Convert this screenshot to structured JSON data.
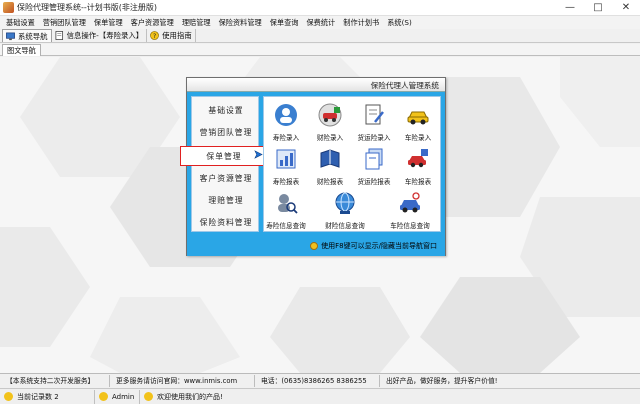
{
  "window": {
    "title": "保险代理管理系统--计划书版(非注册版)"
  },
  "menubar": {
    "items": [
      "基础设置",
      "营销团队管理",
      "保单管理",
      "客户资源管理",
      "理赔管理",
      "保险资料管理",
      "保单查询",
      "保费统计",
      "制作计划书",
      "系统(S)"
    ]
  },
  "toolbar": {
    "tabs": [
      {
        "label": "系统导航",
        "icon": "monitor-icon"
      },
      {
        "label": "信息操作-【寿险录入】",
        "icon": "document-icon"
      },
      {
        "label": "使用指南",
        "icon": "help-icon"
      }
    ]
  },
  "subtab": {
    "label": "图文导航"
  },
  "nav_window": {
    "title": "保险代理人管理系统",
    "categories": [
      "基础设置",
      "营销团队管理",
      "保单管理",
      "客户资源管理",
      "理赔管理",
      "保险资料管理"
    ],
    "selected_category": "保单管理",
    "tiles": [
      {
        "label": "寿险录入",
        "icon": "person-plus-icon"
      },
      {
        "label": "财险录入",
        "icon": "car-plus-icon"
      },
      {
        "label": "货运险录入",
        "icon": "document-pen-icon"
      },
      {
        "label": "车险录入",
        "icon": "car-icon"
      },
      {
        "label": "寿险报表",
        "icon": "chart-icon"
      },
      {
        "label": "财险报表",
        "icon": "book-icon"
      },
      {
        "label": "货运险报表",
        "icon": "files-icon"
      },
      {
        "label": "车险报表",
        "icon": "car-report-icon"
      },
      {
        "label": "寿险信息查询",
        "icon": "person-search-icon"
      },
      {
        "label": "财险信息查询",
        "icon": "globe-search-icon"
      },
      {
        "label": "车险信息查询",
        "icon": "car-search-icon"
      }
    ],
    "footer_hint": "使用F8键可以显示/隐藏当前导航窗口"
  },
  "infobar": {
    "cells": [
      "【本系统支持二次开发服务】",
      "更多服务请访问官网：www.inmis.com",
      "电话：(0635)8386265 8386255",
      "出好产品，做好服务，提升客户价值!"
    ]
  },
  "statusbar": {
    "record_count": "当前记录数 2",
    "user": "Admin",
    "welcome": "欢迎使用我们的产品!"
  },
  "colors": {
    "nav_blue": "#2aa6e6",
    "highlight_red": "#e02020"
  }
}
